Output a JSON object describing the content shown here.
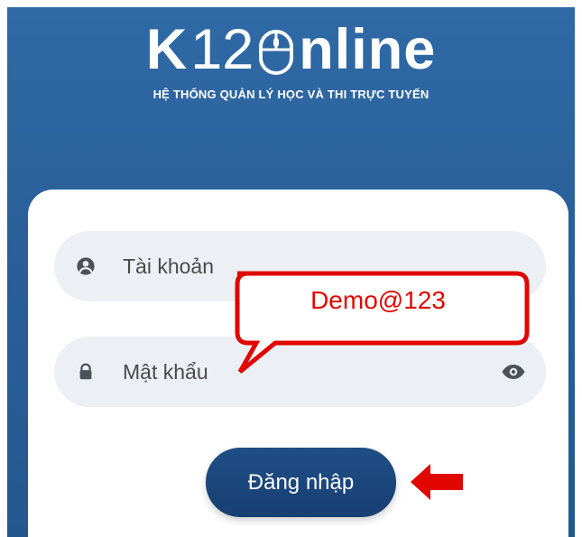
{
  "colors": {
    "header_blue": "#2a5f98",
    "field_bg": "#eceff4",
    "button_blue": "#1f4f86",
    "annotation_red": "#e10600",
    "text_gray": "#4a4a4a"
  },
  "logo": {
    "k": "K",
    "digits": "12",
    "suffix": "nline",
    "subtitle": "HỆ THỐNG QUẢN LÝ HỌC VÀ THI TRỰC TUYẾN"
  },
  "form": {
    "username_placeholder": "Tài khoản",
    "username_value": "",
    "password_placeholder": "Mật khẩu",
    "password_value": "",
    "login_label": "Đăng nhập"
  },
  "annotation": {
    "callout_text": "Demo@123"
  },
  "icons": {
    "logo_mouse": "mouse-icon",
    "user": "user-icon",
    "lock": "lock-icon",
    "show_password": "eye-icon",
    "pointer_arrow": "arrow-left-icon"
  }
}
